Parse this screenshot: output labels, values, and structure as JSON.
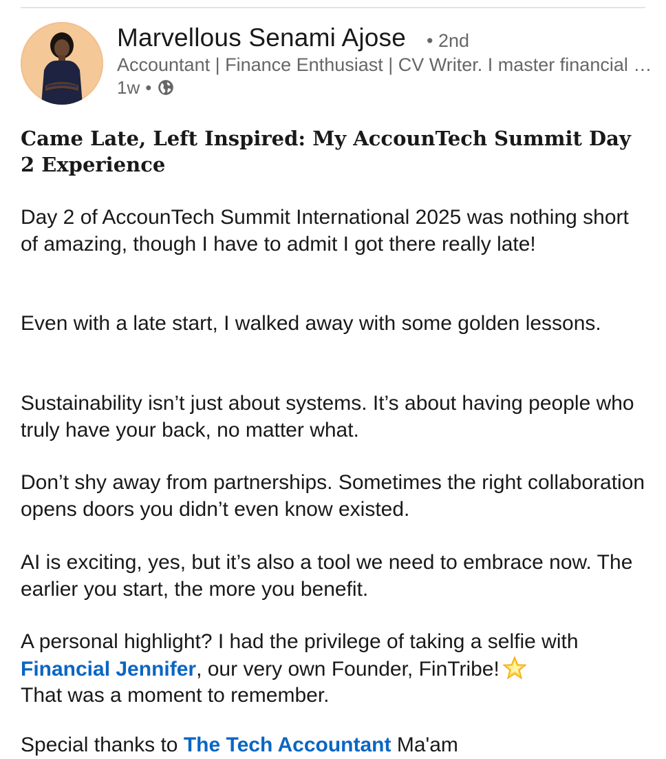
{
  "post": {
    "author": {
      "name": "Marvellous Senami Ajose",
      "degree": "• 2nd",
      "headline": "Accountant | Finance Enthusiast | CV Writer. I master financial reporting",
      "time": "1w",
      "dot": "•",
      "visibility_icon": "globe-icon"
    },
    "title": "Came Late, Left Inspired: My AccounTech Summit Day 2 Experience",
    "paragraphs": {
      "p1": "Day 2 of AccounTech Summit International 2025 was nothing short of amazing, though I have to admit I got there really late!",
      "p2": "Even with a late start, I walked away with some golden lessons.",
      "p3": "Sustainability isn’t just about systems. It’s about having people who truly have your back, no matter what.",
      "p4": "Don’t shy away from partnerships. Sometimes the right collaboration opens doors you didn’t even know existed.",
      "p5": "AI is exciting, yes, but it’s also a tool we need to embrace now. The earlier you start, the more you benefit.",
      "p6_before": "A personal highlight? I had the privilege of taking a selfie with ",
      "p6_mention": "Financial Jennifer",
      "p6_after": ", our very own Founder, FinTribe!",
      "p6_emoji": "glowing-star-emoji",
      "p6_end": "That was a moment to remember.",
      "p7_before": "Special thanks to ",
      "p7_mention": "The Tech Accountant",
      "p7_after": " Ma'am"
    },
    "colors": {
      "text": "#191919",
      "secondary": "#666666",
      "link": "#0a66c2"
    }
  }
}
